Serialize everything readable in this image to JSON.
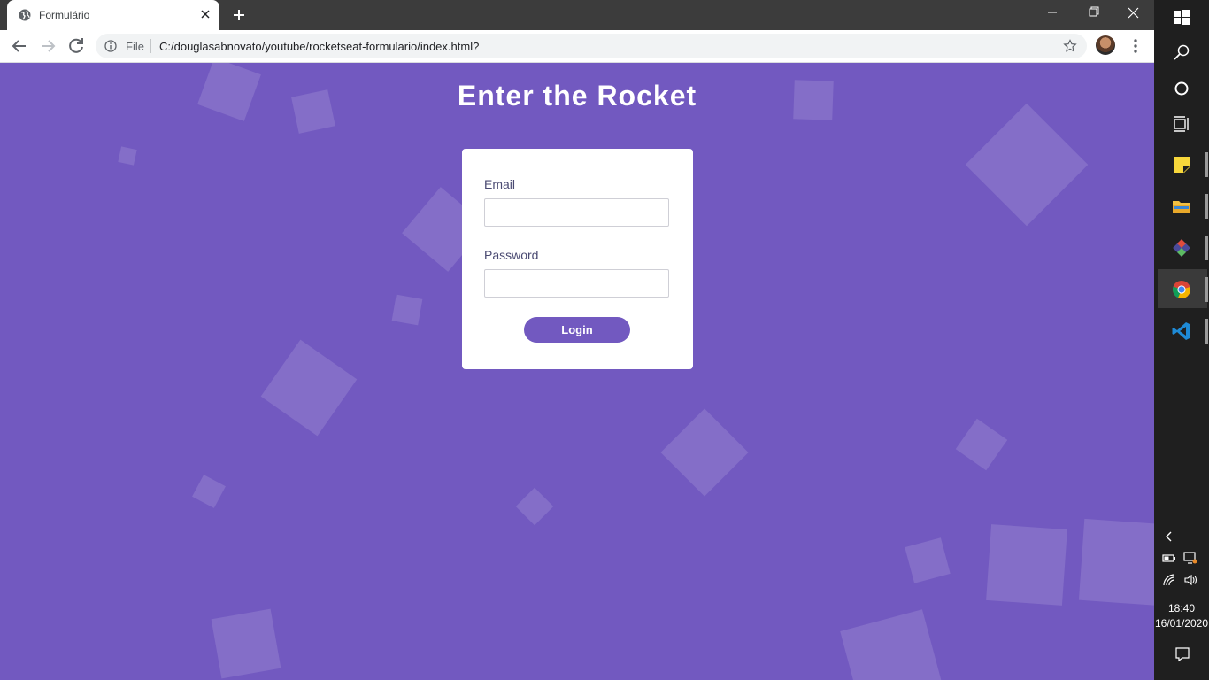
{
  "browser": {
    "tab": {
      "title": "Formulário"
    },
    "address": {
      "scheme_label": "File",
      "url": "C:/douglasabnovato/youtube/rocketseat-formulario/index.html?"
    }
  },
  "page": {
    "title": "Enter the Rocket",
    "form": {
      "email_label": "Email",
      "email_value": "",
      "password_label": "Password",
      "password_value": "",
      "login_label": "Login"
    },
    "colors": {
      "background": "#7259c0",
      "button": "#7259c0",
      "card": "#ffffff"
    }
  },
  "taskbar": {
    "apps": [
      "windows-start-icon",
      "search-icon",
      "cortana-icon",
      "task-view-icon",
      "sticky-notes-icon",
      "file-explorer-icon",
      "git-icon",
      "chrome-icon",
      "vscode-icon"
    ],
    "clock": {
      "time": "18:40",
      "date": "16/01/2020"
    }
  }
}
